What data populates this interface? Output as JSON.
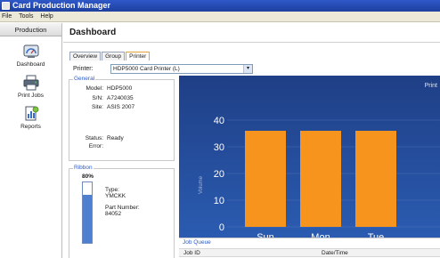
{
  "window": {
    "title": "Card Production Manager"
  },
  "menu": [
    "File",
    "Tools",
    "Help"
  ],
  "sidebar": {
    "header": "Production",
    "items": [
      {
        "label": "Dashboard",
        "icon": "dashboard-icon"
      },
      {
        "label": "Print Jobs",
        "icon": "printer-icon"
      },
      {
        "label": "Reports",
        "icon": "reports-icon"
      }
    ]
  },
  "main": {
    "title": "Dashboard",
    "tabs": [
      {
        "label": "Overview",
        "active": false
      },
      {
        "label": "Group",
        "active": false
      },
      {
        "label": "Printer",
        "active": true
      }
    ],
    "printer_label": "Printer:",
    "printer_value": "HDP5000 Card Printer (L)"
  },
  "general": {
    "legend": "General",
    "model_label": "Model:",
    "model_value": "HDP5000",
    "sn_label": "S/N:",
    "sn_value": "A7240035",
    "site_label": "Site:",
    "site_value": "ASIS 2007",
    "status_label": "Status:",
    "status_value": "Ready",
    "error_label": "Error:",
    "error_value": ""
  },
  "ribbon": {
    "legend": "Ribbon",
    "percent_label": "80%",
    "level": 0.8,
    "type_label": "Type:",
    "type_value": "YMCKK",
    "part_label": "Part Number:",
    "part_value": "84052"
  },
  "chart_data": {
    "type": "bar",
    "title": "Print",
    "ylabel": "Volume",
    "ylim": [
      0,
      50
    ],
    "yticks": [
      0,
      10,
      20,
      30,
      40
    ],
    "categories": [
      "Sun",
      "Mon",
      "Tue"
    ],
    "values": [
      36,
      36,
      36
    ],
    "colors": {
      "bar": "#f7941d",
      "background_top": "#1f3f86",
      "background_bottom": "#2c5fb6"
    },
    "grid": true
  },
  "job_queue": {
    "title": "Job Queue",
    "columns": [
      "Job ID",
      "Date/Time"
    ]
  },
  "colors": {
    "accent": "#2a5bc7",
    "titlebar": "#2448b0",
    "tab_active_border": "#e4a33b"
  }
}
